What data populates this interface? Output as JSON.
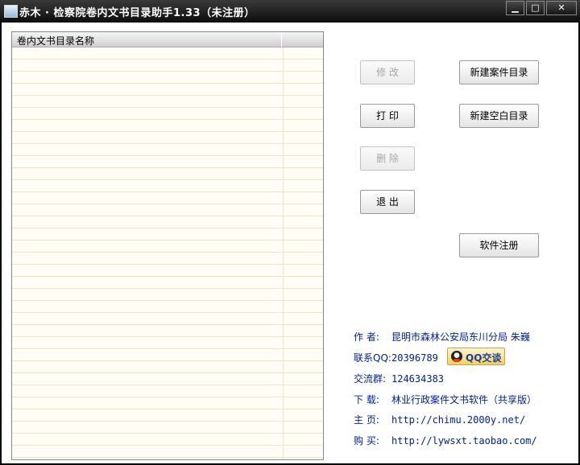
{
  "window": {
    "title": "赤木 · 检察院卷内文书目录助手1.33（未注册）",
    "controls": {
      "minimize": "▁",
      "maximize": "□",
      "close": "✕"
    }
  },
  "list": {
    "column_header": "卷内文书目录名称",
    "rows": []
  },
  "buttons": {
    "modify": "修 改",
    "print": "打 印",
    "delete": "删 除",
    "exit": "退 出",
    "new_case_dir": "新建案件目录",
    "new_blank_dir": "新建空白目录",
    "register": "软件注册"
  },
  "info": {
    "author_label": "作  者:",
    "author_value": "昆明市森林公安局东川分局  朱巍",
    "qq_label": "联系QQ:",
    "qq_value": "20396789",
    "qq_button": "QQ交谈",
    "group_label": "交流群:",
    "group_value": "124634383",
    "download_label": "下  载:",
    "download_value": "林业行政案件文书软件（共享版）",
    "home_label": "主  页:",
    "home_value": "http://chimu.2000y.net/",
    "buy_label": "购  买:",
    "buy_value": "http://lywsxt.taobao.com/"
  },
  "colors": {
    "titlebar": "#0c0c0c",
    "info_text": "#00229a",
    "disabled_text": "#a8a8a8",
    "list_row_line": "#ece6c8"
  }
}
